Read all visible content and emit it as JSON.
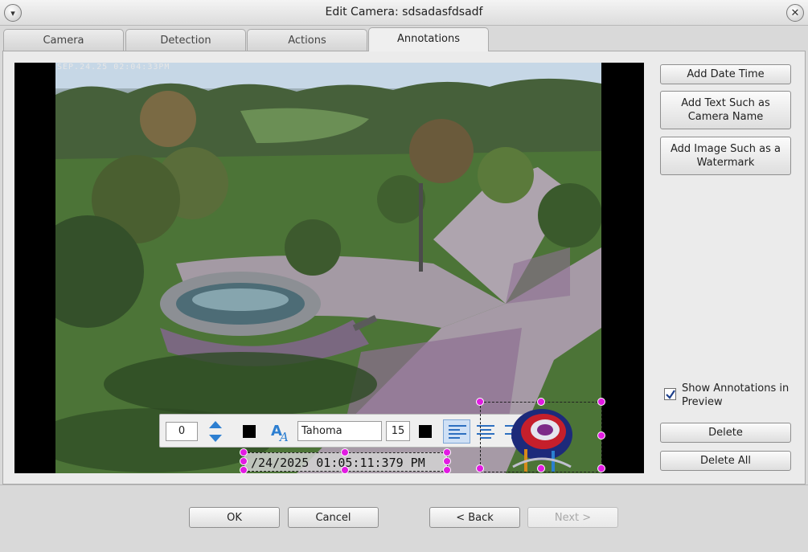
{
  "window": {
    "title": "Edit Camera: sdsadasfdsadf"
  },
  "tabs": [
    {
      "label": "Camera"
    },
    {
      "label": "Detection"
    },
    {
      "label": "Actions"
    },
    {
      "label": "Annotations",
      "active": true
    }
  ],
  "preview": {
    "osd_text": "SEP.24.25 02:04:33PM"
  },
  "annotation_toolbar": {
    "rotation_value": "0",
    "font_name": "Tahoma",
    "font_size": "15",
    "color": "#000000",
    "alignment": "left"
  },
  "annotations": {
    "datetime_text": "/24/2025 01:05:11:379 PM"
  },
  "right_panel": {
    "add_date_time": "Add Date Time",
    "add_text": "Add Text Such as Camera Name",
    "add_image": "Add Image Such as a Watermark",
    "show_annotations_label": "Show Annotations in Preview",
    "show_annotations_checked": true,
    "delete": "Delete",
    "delete_all": "Delete All"
  },
  "footer": {
    "ok": "OK",
    "cancel": "Cancel",
    "back": "<  Back",
    "next": "Next  >"
  },
  "icons": {
    "menu": "chevron-down-icon",
    "close": "close-icon",
    "spin": "up-down-arrows-icon",
    "font": "font-icon",
    "align_left": "align-left-icon",
    "align_center": "align-center-icon",
    "align_right": "align-right-icon",
    "check": "checkmark-icon"
  }
}
